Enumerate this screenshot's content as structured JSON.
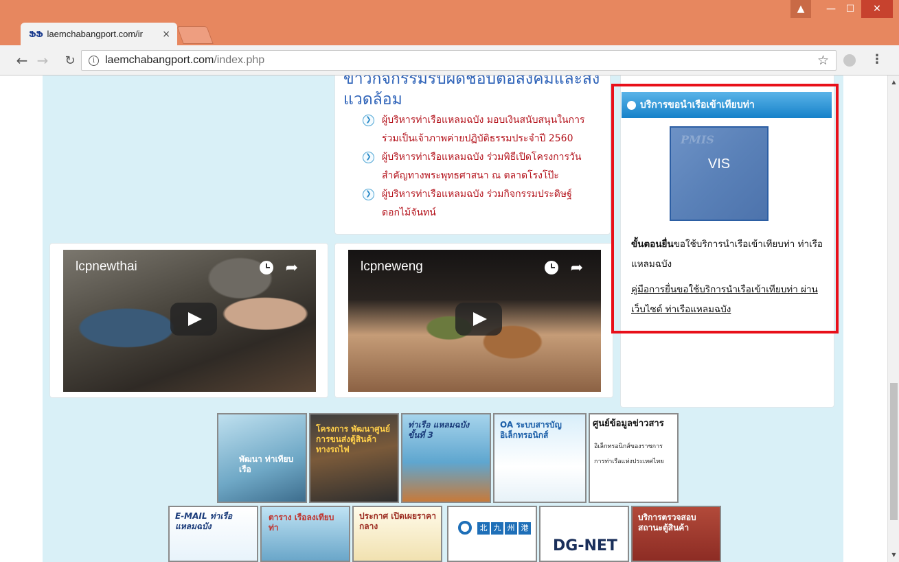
{
  "browser": {
    "tab_favicon": "ՖՖ",
    "tab_title": "laemchabangport.com/ir",
    "tab_close": "×",
    "url_host": "laemchabangport.com",
    "url_path": "/index.php",
    "info_glyph": "i"
  },
  "news": {
    "heading": "ข่าวกิจกรรมรับผิดชอบต่อสังคมและสิ่งแวดล้อม",
    "items": [
      "ผู้บริหารท่าเรือแหลมฉบัง มอบเงินสนับสนุนในการร่วมเป็นเจ้าภาพค่ายปฏิบัติธรรมประจำปี 2560",
      "ผู้บริหารท่าเรือแหลมฉบัง ร่วมพิธีเปิดโครงการวันสำคัญทางพระพุทธศาสนา ณ ตลาดโรงโป๊ะ",
      "ผู้บริหารท่าเรือแหลมฉบัง ร่วมกิจกรรมประดิษฐ์ดอกไม้จันทน์"
    ]
  },
  "videos": [
    {
      "title": "lcpnewthai"
    },
    {
      "title": "lcpneweng"
    }
  ],
  "sidebar": {
    "service_title": "บริการขอนำเรือเข้าเทียบท่า",
    "tile_label": "VIS",
    "tile_watermark": "PMIS",
    "steps_bold": "ขั้นตอนยื่น",
    "steps_rest": "ขอใช้บริการนำเรือเข้าเทียบท่า ท่าเรือแหลมฉบัง",
    "manual_link": "คู่มือการยื่นขอใช้บริการนำเรือเข้าเทียบท่า ผ่านเว็บไซต์ ท่าเรือแหลมฉบัง"
  },
  "banners": {
    "b1": "พัฒนา ท่าเทียบเรือ",
    "b2": "โครงการ พัฒนาศูนย์ การขนส่งตู้สินค้า ทางรถไฟ",
    "b3": "ท่าเรือ แหลมฉบัง ขั้นที่ 3",
    "b4": "OA ระบบสารบัญ อิเล็กทรอนิกส์",
    "b5_title": "ศูนย์ข้อมูลข่าวสาร",
    "b5_sub1": "อิเล็กทรอนิกส์ของราชการ",
    "b5_sub2": "การท่าเรือแห่งประเทศไทย",
    "b6": "E-MAIL ท่าเรือแหลมฉบัง",
    "b7": "ตาราง เรือลงเทียบท่า",
    "b8": "ประกาศ เปิดเผยราคากลาง",
    "b9_chars": [
      "北",
      "九",
      "州",
      "港"
    ],
    "b10": "DG-NET",
    "b11": "บริการตรวจสอบสถานะตู้สินค้า"
  },
  "colors": {
    "page_bg": "#d9f0f7",
    "highlight": "#e8101a",
    "news_red": "#b4131c",
    "header_blue": "#1681c9"
  }
}
